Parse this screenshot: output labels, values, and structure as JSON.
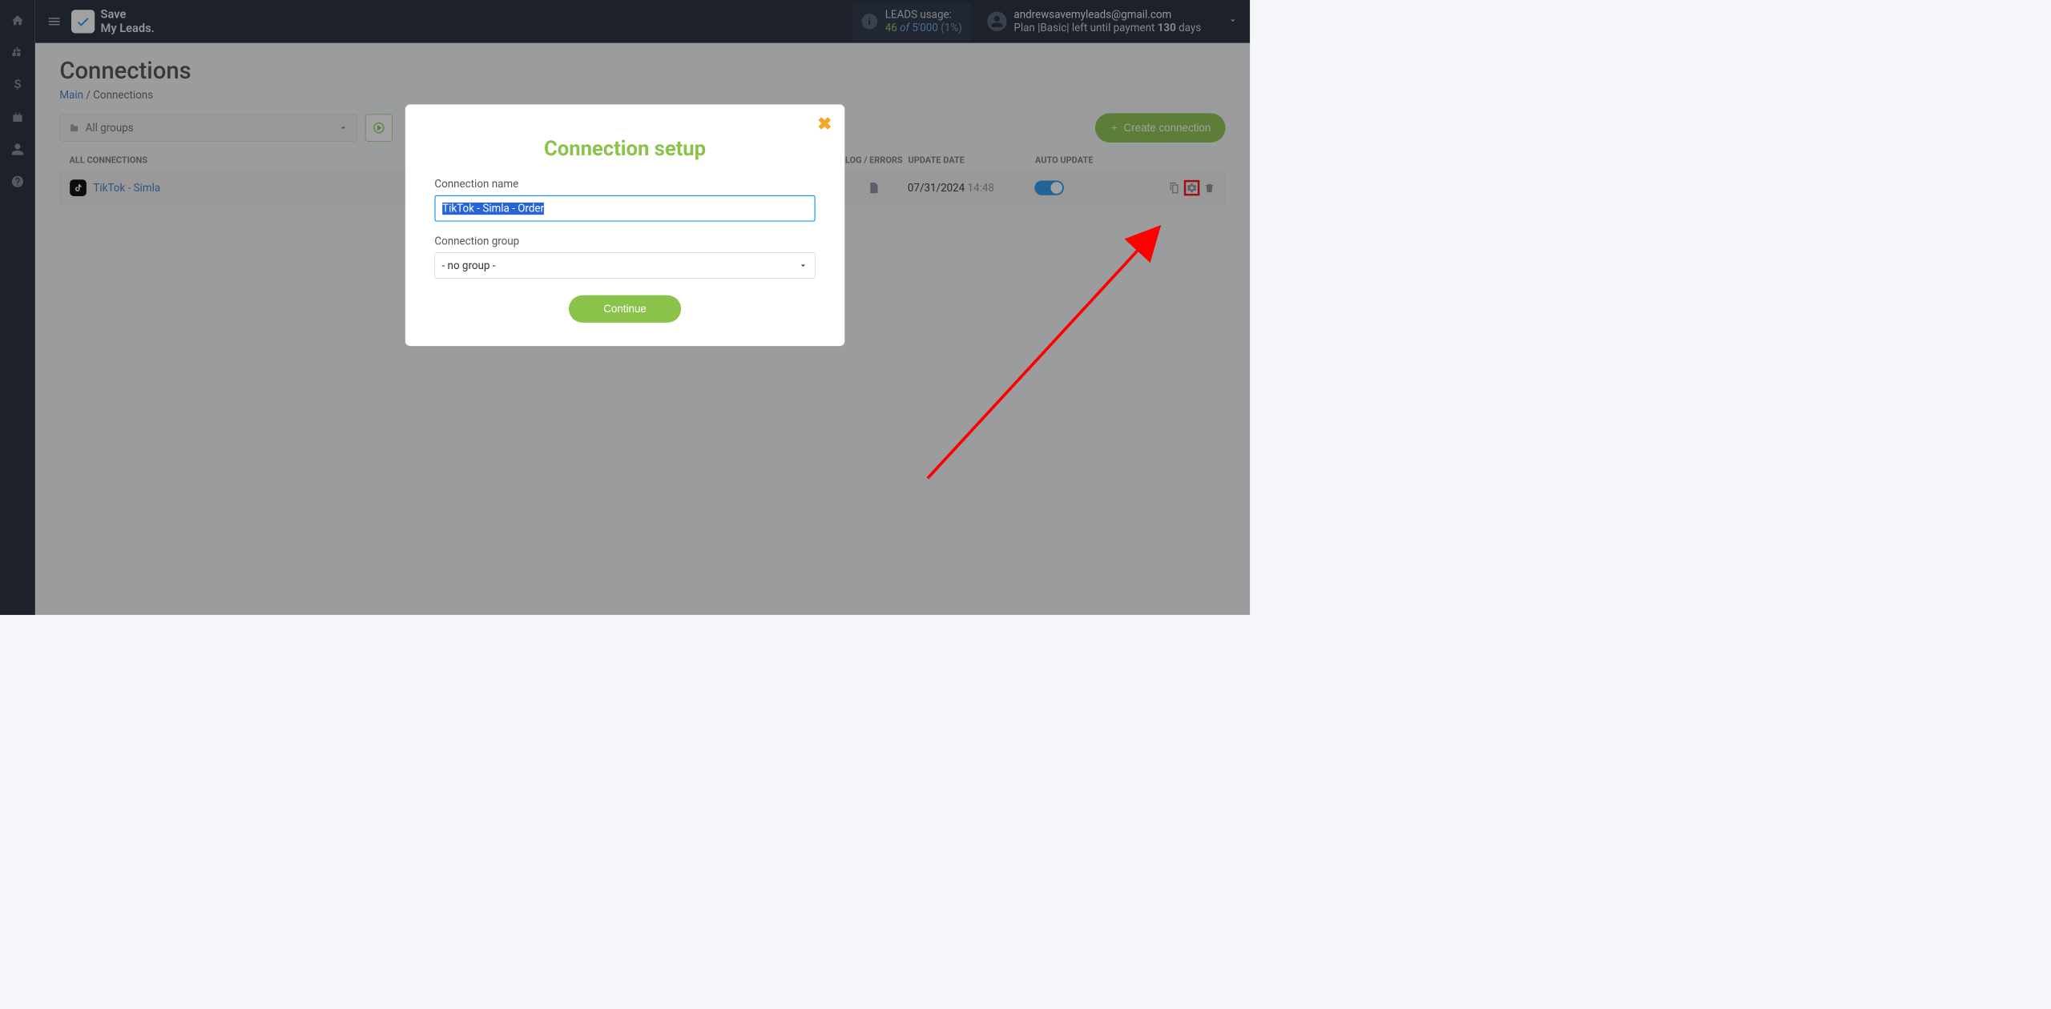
{
  "brand": {
    "line1": "Save",
    "line2": "My Leads."
  },
  "usage": {
    "label": "LEADS usage:",
    "num": "46",
    "of": "of",
    "total": "5'000",
    "pct": "(1%)"
  },
  "account": {
    "email": "andrewsavemyleads@gmail.com",
    "plan_prefix": "Plan |",
    "plan_name": "Basic",
    "plan_mid": "| left until payment ",
    "plan_days": "130",
    "plan_suffix": " days"
  },
  "page": {
    "title": "Connections",
    "bc_main": "Main",
    "bc_sep": " / ",
    "bc_current": "Connections",
    "group_selector": "All groups",
    "create_btn": "Create connection"
  },
  "table": {
    "h_name": "ALL CONNECTIONS",
    "h_log": "LOG / ERRORS",
    "h_date": "UPDATE DATE",
    "h_auto": "AUTO UPDATE",
    "rows": [
      {
        "name": "TikTok - Simla",
        "date": "07/31/2024",
        "time": "14:48"
      }
    ]
  },
  "modal": {
    "title": "Connection setup",
    "name_label": "Connection name",
    "name_value": "TikTok - Simla - Order",
    "group_label": "Connection group",
    "group_value": "- no group -",
    "continue": "Continue"
  }
}
